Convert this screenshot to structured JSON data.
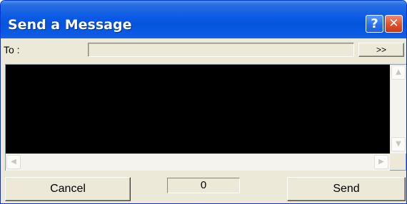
{
  "window": {
    "title": "Send a Message",
    "help_label": "?",
    "close_label": "✕"
  },
  "recipient": {
    "label": "To :",
    "value": "",
    "expand_label": ">>"
  },
  "message": {
    "text": "",
    "background_color": "#000000"
  },
  "scrollbars": {
    "up_icon": "▲",
    "down_icon": "▼",
    "left_icon": "◀",
    "right_icon": "▶"
  },
  "footer": {
    "cancel_label": "Cancel",
    "character_count": "0",
    "send_label": "Send"
  }
}
